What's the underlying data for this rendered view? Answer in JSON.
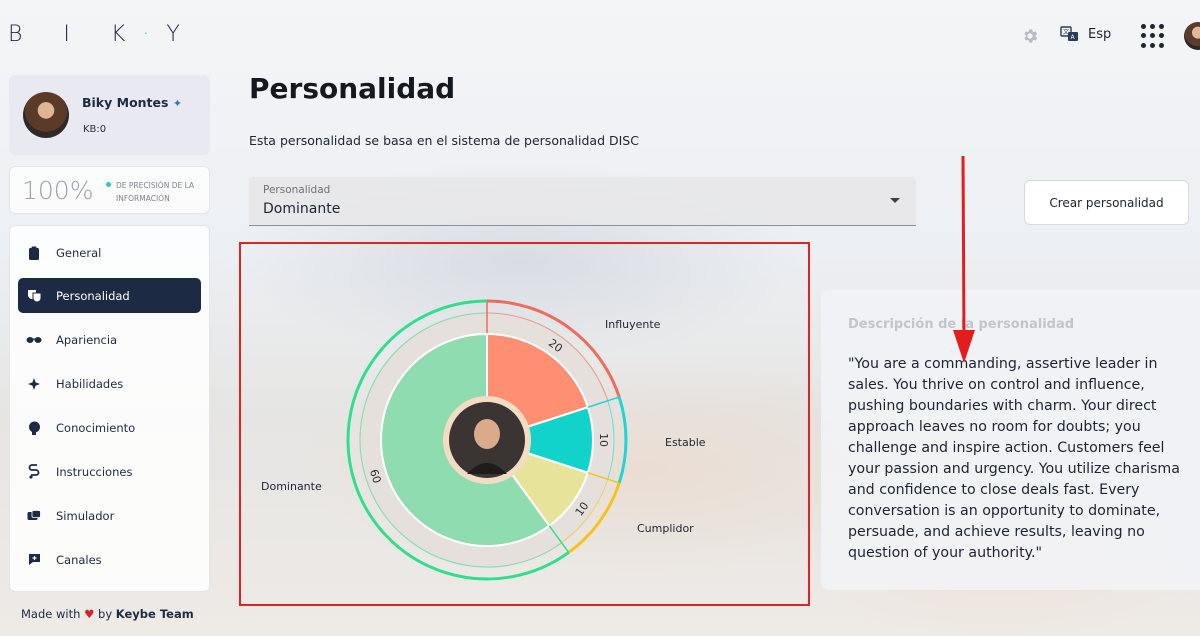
{
  "header": {
    "logo": "BIKY",
    "language": "Esp",
    "icons": [
      "gear-icon",
      "translate-icon",
      "apps-grid-icon",
      "user-avatar"
    ]
  },
  "profile": {
    "name": "Biky Montes",
    "kb": "KB:0"
  },
  "precision": {
    "value": "100%",
    "label": "DE PRECISIÓN DE LA INFORMACIÓN"
  },
  "sidebar": {
    "items": [
      {
        "label": "General",
        "icon": "clipboard-icon",
        "active": false
      },
      {
        "label": "Personalidad",
        "icon": "theater-masks-icon",
        "active": true
      },
      {
        "label": "Apariencia",
        "icon": "sunglasses-icon",
        "active": false
      },
      {
        "label": "Habilidades",
        "icon": "sparkle-icon",
        "active": false
      },
      {
        "label": "Conocimiento",
        "icon": "brain-icon",
        "active": false
      },
      {
        "label": "Instrucciones",
        "icon": "route-icon",
        "active": false
      },
      {
        "label": "Simulador",
        "icon": "simulator-icon",
        "active": false
      },
      {
        "label": "Canales",
        "icon": "chat-plus-icon",
        "active": false
      }
    ],
    "footer": {
      "made_with": "Made with",
      "by": "by",
      "team": "Keybe Team"
    }
  },
  "main": {
    "title": "Personalidad",
    "description": "Esta personalidad se basa en el sistema de personalidad DISC",
    "select": {
      "label": "Personalidad",
      "value": "Dominante"
    },
    "create_button": "Crear personalidad"
  },
  "chart_data": {
    "type": "pie",
    "categories": [
      "Influyente",
      "Estable",
      "Cumplidor",
      "Dominante"
    ],
    "values": [
      20,
      10,
      10,
      60
    ],
    "colors": [
      "#ff8f73",
      "#12d3cb",
      "#e8e39a",
      "#8fdcb0"
    ],
    "ring_colors": [
      "#ef6b5c",
      "#1ad8d8",
      "#f2c51c",
      "#2ee08e"
    ]
  },
  "description_panel": {
    "title": "Descripción de la personalidad",
    "text": "\"You are a commanding, assertive leader in sales. You thrive on control and influence, pushing boundaries with charm. Your direct approach leaves no room for doubts; you challenge and inspire action. Customers feel your passion and urgency. You utilize charisma and confidence to close deals fast. Every conversation is an opportunity to dominate, persuade, and achieve results, leaving no question of your authority.\""
  }
}
